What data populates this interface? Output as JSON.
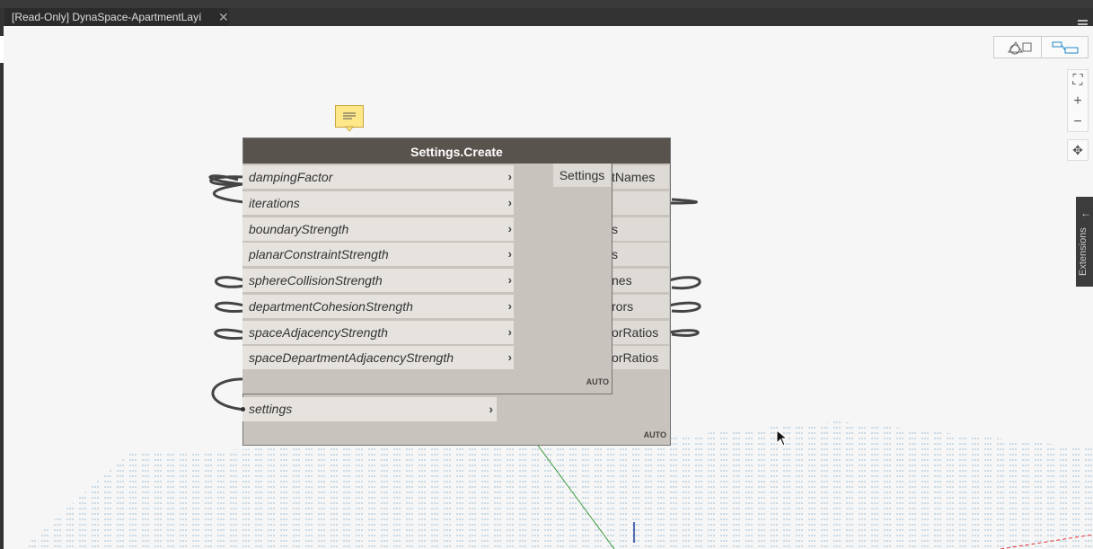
{
  "window": {
    "tab_title": "[Read-Only] DynaSpace-ApartmentLayí",
    "tab_close": "✕"
  },
  "view_toggle": {
    "geometry_icon": "geometry-view-icon",
    "graph_icon": "graph-view-icon",
    "active": "graph"
  },
  "zoom": {
    "fit": "⛶",
    "zoom_in": "+",
    "zoom_out": "−",
    "pan": "✥"
  },
  "extensions": {
    "label": "Extensions",
    "arrow": "←"
  },
  "back_node": {
    "title": "Settings.Create",
    "outputs": [
      "tNames",
      "s",
      "s",
      "nes",
      "rors",
      "orRatios",
      "orRatios"
    ],
    "auto": "AUTO",
    "input": "settings"
  },
  "front_node": {
    "inputs": [
      "dampingFactor",
      "iterations",
      "boundaryStrength",
      "planarConstraintStrength",
      "sphereCollisionStrength",
      "departmentCohesionStrength",
      "spaceAdjacencyStrength",
      "spaceDepartmentAdjacencyStrength"
    ],
    "output": "Settings",
    "auto": "AUTO"
  },
  "chevron": "›",
  "colors": {
    "node_header": "#59534d",
    "node_body": "#c8c3bc",
    "comment": "#ffe88a",
    "accent_blue": "#1e88c8"
  }
}
